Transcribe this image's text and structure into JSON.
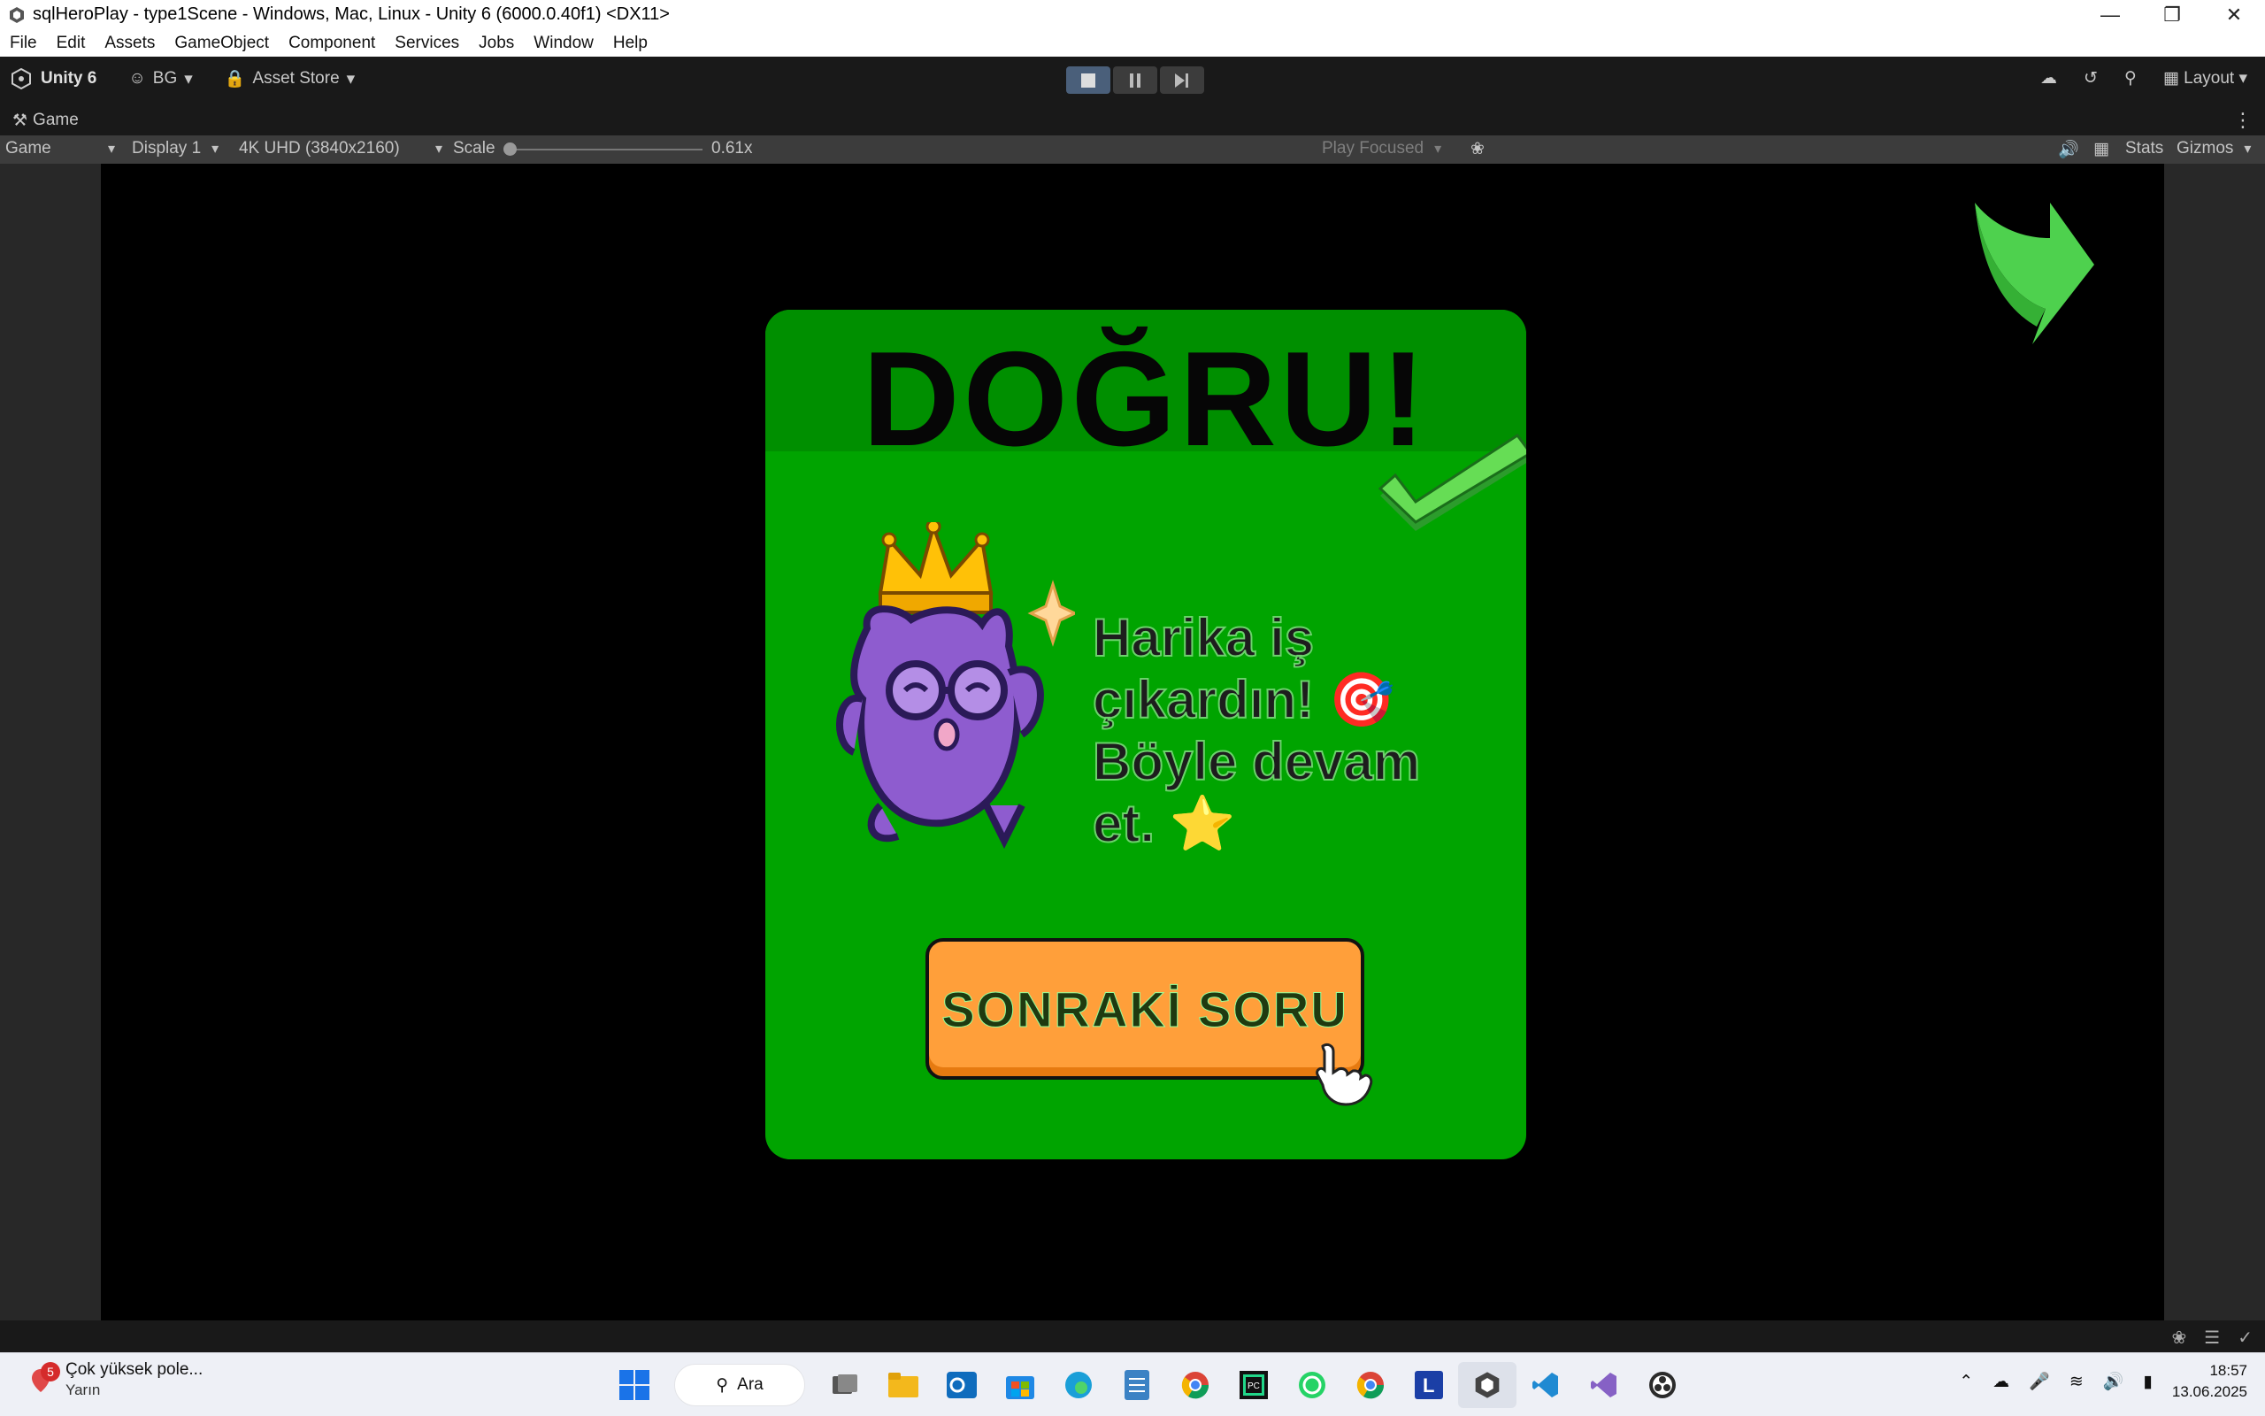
{
  "window": {
    "title": "sqlHeroPlay - type1Scene - Windows, Mac, Linux - Unity 6 (6000.0.40f1) <DX11>",
    "controls": [
      "minimize",
      "restore",
      "close"
    ]
  },
  "menu": [
    "File",
    "Edit",
    "Assets",
    "GameObject",
    "Component",
    "Services",
    "Jobs",
    "Window",
    "Help"
  ],
  "toolbar": {
    "unity_label": "Unity 6",
    "account": "BG",
    "asset_store": "Asset Store",
    "layout": "Layout"
  },
  "game_tab": {
    "label": "Game"
  },
  "game_bar": {
    "view_mode": "Game",
    "display": "Display 1",
    "resolution": "4K UHD (3840x2160)",
    "scale_label": "Scale",
    "scale_value": "0.61x",
    "scale_level": 0.0,
    "play_mode": "Play Focused",
    "stats": "Stats",
    "gizmos": "Gizmos"
  },
  "game": {
    "title": "DOĞRU!",
    "message": "Harika iş çıkardın! 🎯 Böyle devam et. ⭐",
    "next_button": "SONRAKİ SORU",
    "colors": {
      "panel": "#00a400",
      "header": "#008f00",
      "button": "#ff9f3a"
    }
  },
  "taskbar": {
    "notification_title": "Çok yüksek pole...",
    "notification_sub": "Yarın",
    "notification_count": "5",
    "search_label": "Ara",
    "time": "18:57",
    "date": "13.06.2025"
  }
}
